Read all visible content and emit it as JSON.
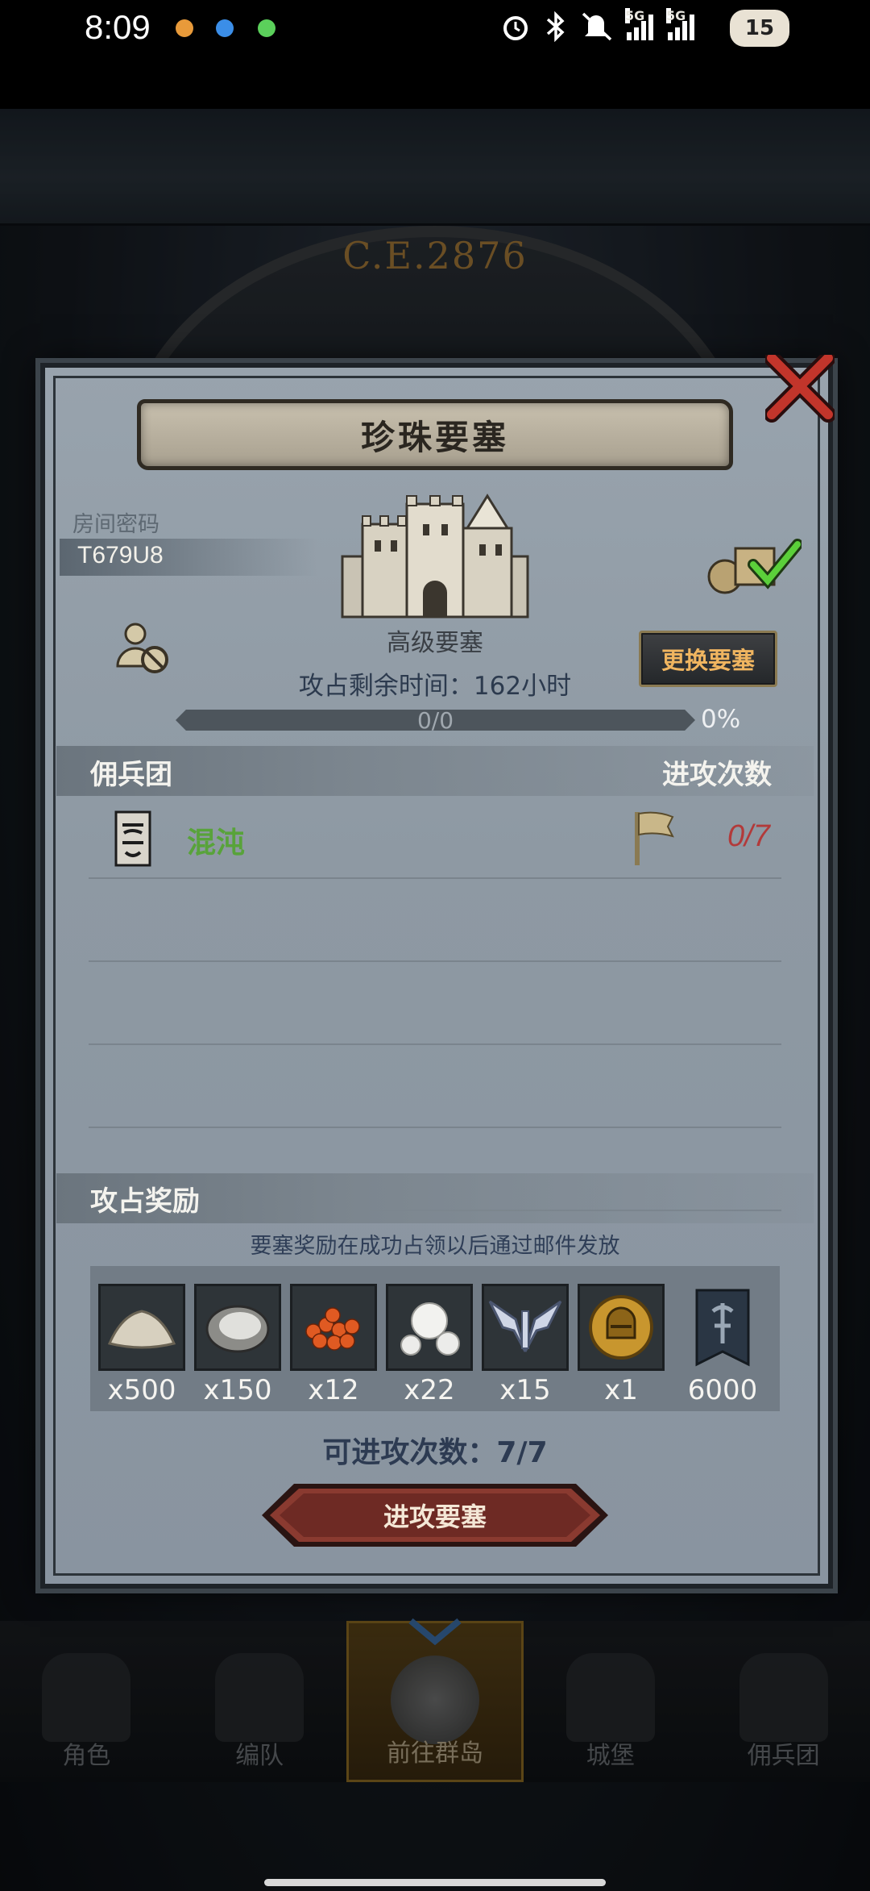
{
  "status_bar": {
    "time": "8:09",
    "network_1": "5G",
    "network_2": "5G",
    "battery": "15"
  },
  "background": {
    "era": "C.E.2876"
  },
  "modal": {
    "title": "珍珠要塞",
    "room_label": "房间密码",
    "room_code": "T679U8",
    "fort_level": "高级要塞",
    "change_button": "更换要塞",
    "remaining_time": "攻占剩余时间：162小时",
    "progress_text": "0/0",
    "progress_percent": "0%",
    "progress_fraction": 0,
    "mercenary_header": "佣兵团",
    "attacks_header": "进攻次数",
    "mercenaries": [
      {
        "name": "混沌",
        "count": "0/7"
      }
    ],
    "rewards_header": "攻占奖励",
    "reward_note": "要塞奖励在成功占领以后通过邮件发放",
    "rewards": [
      {
        "icon": "flour-icon",
        "qty": "x500"
      },
      {
        "icon": "oyster-icon",
        "qty": "x150"
      },
      {
        "icon": "roe-icon",
        "qty": "x12"
      },
      {
        "icon": "pearl-icon",
        "qty": "x22"
      },
      {
        "icon": "wings-emblem-icon",
        "qty": "x15"
      },
      {
        "icon": "helmet-coin-icon",
        "qty": "x1"
      },
      {
        "icon": "banner-icon",
        "qty": "6000"
      }
    ],
    "attack_count": "可进攻次数：7/7",
    "attack_button": "进攻要塞"
  },
  "bottom_nav": [
    {
      "label": "角色",
      "active": false
    },
    {
      "label": "编队",
      "active": false
    },
    {
      "label": "前往群岛",
      "active": true
    },
    {
      "label": "城堡",
      "active": false
    },
    {
      "label": "佣兵团",
      "active": false
    }
  ],
  "colors": {
    "accent_gold": "#f0b560",
    "mercenary_green": "#58a33a",
    "count_red": "#b23a3a",
    "attack_button": "#8a3a30"
  }
}
